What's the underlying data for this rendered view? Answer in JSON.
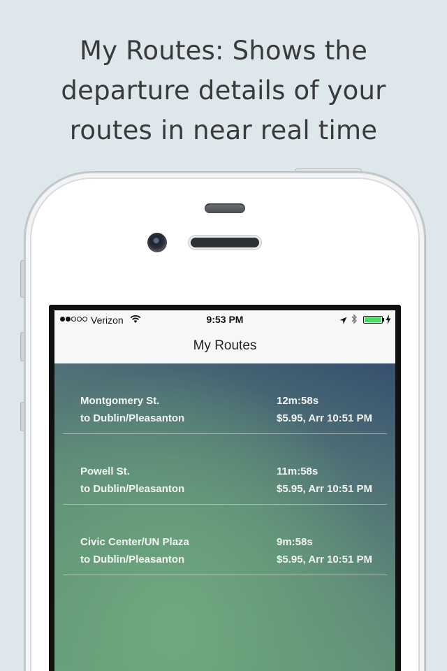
{
  "caption": {
    "line1": "My Routes: Shows the",
    "line2": "departure details of your",
    "line3": "routes in near real time"
  },
  "status_bar": {
    "signal_strength": 2,
    "signal_max": 5,
    "carrier": "Verizon",
    "time": "9:53 PM",
    "battery_level": 1.0,
    "battery_color": "#4cd964"
  },
  "nav": {
    "title": "My Routes"
  },
  "routes": [
    {
      "station": "Montgomery St.",
      "destination": "to Dublin/Pleasanton",
      "countdown": "12m:58s",
      "fare_arrival": "$5.95, Arr 10:51 PM"
    },
    {
      "station": "Powell St.",
      "destination": "to Dublin/Pleasanton",
      "countdown": "11m:58s",
      "fare_arrival": "$5.95, Arr 10:51 PM"
    },
    {
      "station": "Civic Center/UN Plaza",
      "destination": "to Dublin/Pleasanton",
      "countdown": "9m:58s",
      "fare_arrival": "$5.95, Arr 10:51 PM"
    }
  ],
  "icons": {
    "wifi": "wifi-icon",
    "location": "location-arrow-icon",
    "bluetooth": "bluetooth-icon",
    "battery": "battery-icon",
    "charging": "charging-bolt-icon"
  },
  "colors": {
    "background": "#dde7ec",
    "gradient_top": "#36506e",
    "gradient_bottom": "#6aa07c"
  }
}
